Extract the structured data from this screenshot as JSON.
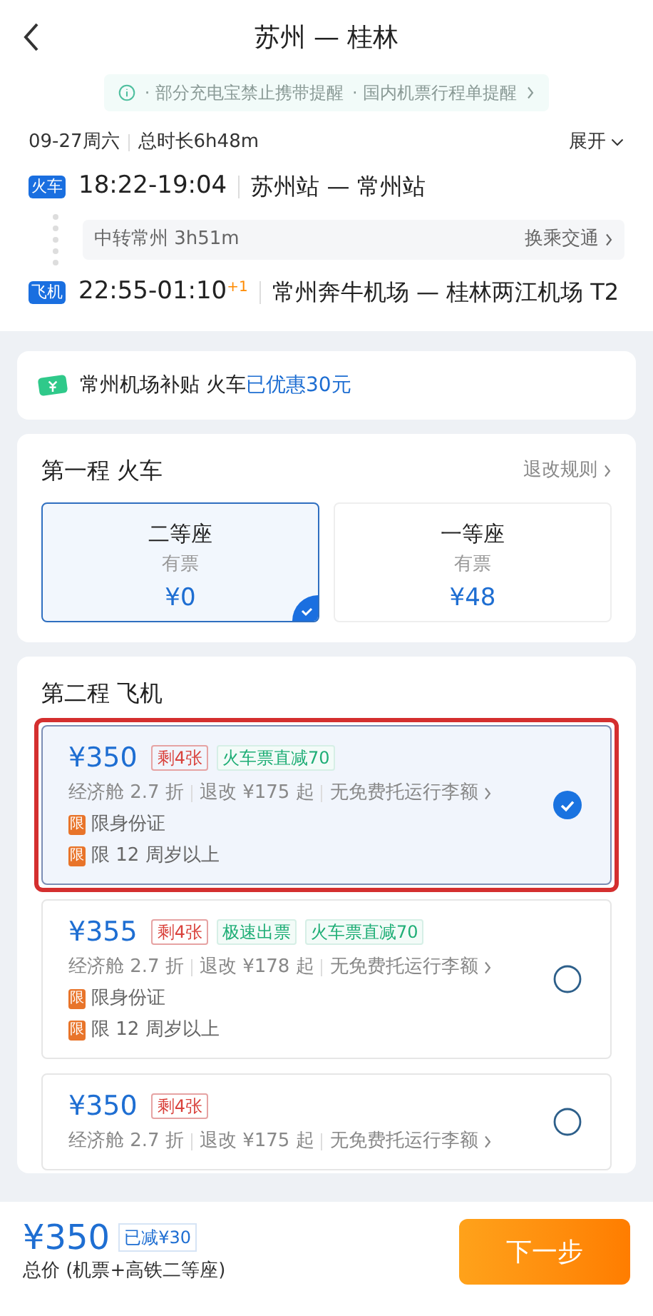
{
  "header": {
    "title": "苏州 — 桂林"
  },
  "notice": {
    "items": [
      "· 部分充电宝禁止携带提醒",
      "· 国内机票行程单提醒"
    ]
  },
  "summary": {
    "date": "09-27周六",
    "duration": "总时长6h48m",
    "expand": "展开"
  },
  "legs": [
    {
      "kind": "train",
      "badge": "火车",
      "time": "18:22-19:04",
      "route": "苏州站 — 常州站"
    },
    {
      "kind": "transfer",
      "text": "中转常州 3h51m",
      "link": "换乘交通"
    },
    {
      "kind": "flight",
      "badge": "飞机",
      "time": "22:55-01:10",
      "day_offset": "+1",
      "route": "常州奔牛机场 — 桂林两江机场 T2"
    }
  ],
  "subsidy": {
    "text": "常州机场补贴 火车",
    "highlight": "已优惠30元"
  },
  "train_section": {
    "title": "第一程 火车",
    "rules": "退改规则",
    "seats": [
      {
        "name": "二等座",
        "availability": "有票",
        "price": "¥0",
        "selected": true
      },
      {
        "name": "一等座",
        "availability": "有票",
        "price": "¥48",
        "selected": false
      }
    ]
  },
  "flight_section": {
    "title": "第二程 飞机",
    "options": [
      {
        "price": "¥350",
        "tags": [
          {
            "kind": "remaining",
            "text": "剩4张"
          },
          {
            "kind": "promo",
            "text": "火车票直减70"
          }
        ],
        "details": [
          "经济舱 2.7 折",
          "退改 ¥175 起",
          "无免费托运行李额"
        ],
        "limits": [
          {
            "badge": "限",
            "text": "限身份证"
          },
          {
            "badge": "限",
            "text": "限 12 周岁以上"
          }
        ],
        "selected": true,
        "annotated": true
      },
      {
        "price": "¥355",
        "tags": [
          {
            "kind": "remaining",
            "text": "剩4张"
          },
          {
            "kind": "promo",
            "text": "极速出票"
          },
          {
            "kind": "promo",
            "text": "火车票直减70"
          }
        ],
        "details": [
          "经济舱 2.7 折",
          "退改 ¥178 起",
          "无免费托运行李额"
        ],
        "limits": [
          {
            "badge": "限",
            "text": "限身份证"
          },
          {
            "badge": "限",
            "text": "限 12 周岁以上"
          }
        ],
        "selected": false,
        "annotated": false
      },
      {
        "price": "¥350",
        "tags": [
          {
            "kind": "remaining",
            "text": "剩4张"
          }
        ],
        "details": [
          "经济舱 2.7 折",
          "退改 ¥175 起",
          "无免费托运行李额"
        ],
        "selected": false,
        "annotated": false
      }
    ]
  },
  "footer": {
    "price": "¥350",
    "discount": "已减¥30",
    "caption": "总价 (机票+高铁二等座)",
    "next": "下一步"
  }
}
